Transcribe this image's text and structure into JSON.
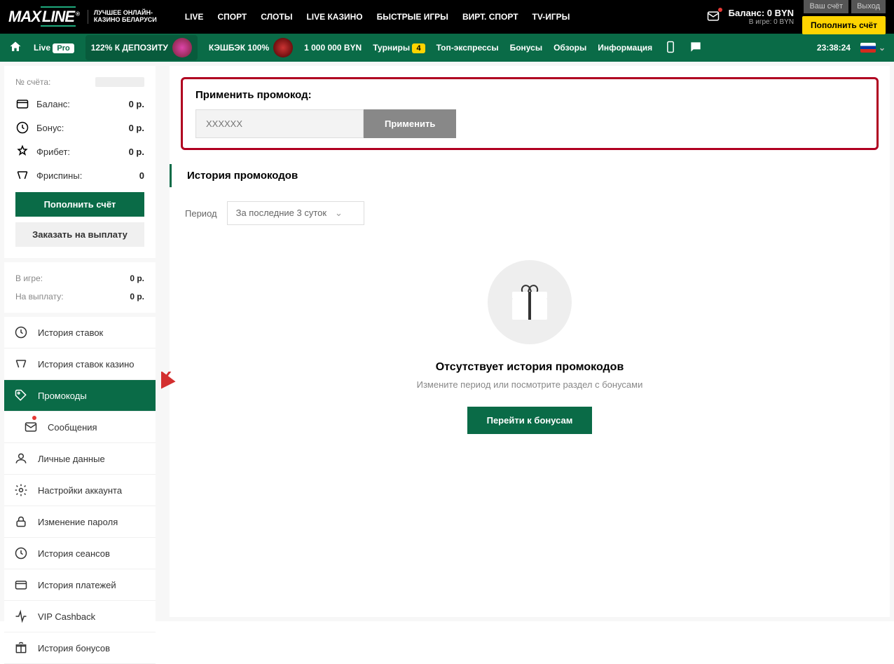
{
  "header": {
    "logo_main": "MAX",
    "logo_sub": "LINE",
    "tagline1": "ЛУЧШЕЕ ОНЛАЙН-",
    "tagline2": "КАЗИНО БЕЛАРУСИ",
    "nav": [
      "LIVE",
      "СПОРТ",
      "СЛОТЫ",
      "LIVE КАЗИНО",
      "БЫСТРЫЕ ИГРЫ",
      "ВИРТ. СПОРТ",
      "TV-ИГРЫ"
    ],
    "balance": "Баланс: 0 BYN",
    "in_game": "В игре: 0 BYN",
    "btn_account": "Ваш счёт",
    "btn_exit": "Выход",
    "btn_deposit": "Пополнить счёт"
  },
  "subheader": {
    "live": "Live",
    "pro": "Pro",
    "deposit_bonus": "122% К ДЕПОЗИТУ",
    "cashback": "КЭШБЭК 100%",
    "million": "1 000 000 BYN",
    "tournaments": "Турниры",
    "tourn_count": "4",
    "top_express": "Топ-экспрессы",
    "bonuses": "Бонусы",
    "reviews": "Обзоры",
    "info": "Информация",
    "time": "23:38:24"
  },
  "sidebar": {
    "account_label": "№ счёта:",
    "rows": [
      {
        "label": "Баланс:",
        "value": "0 р."
      },
      {
        "label": "Бонус:",
        "value": "0 р."
      },
      {
        "label": "Фрибет:",
        "value": "0 р."
      },
      {
        "label": "Фриспины:",
        "value": "0"
      }
    ],
    "btn_deposit": "Пополнить счёт",
    "btn_withdraw": "Заказать на выплату",
    "in_game": {
      "label": "В игре:",
      "value": "0 р."
    },
    "to_payout": {
      "label": "На выплату:",
      "value": "0 р."
    },
    "menu": [
      "История ставок",
      "История ставок казино",
      "Промокоды",
      "Сообщения",
      "Личные данные",
      "Настройки аккаунта",
      "Изменение пароля",
      "История сеансов",
      "История платежей",
      "VIP Cashback",
      "История бонусов"
    ]
  },
  "main": {
    "promo_title": "Применить промокод:",
    "promo_placeholder": "XXXXXX",
    "promo_btn": "Применить",
    "history_title": "История промокодов",
    "period_label": "Период",
    "period_value": "За последние 3 суток",
    "empty_title": "Отсутствует история промокодов",
    "empty_sub": "Измените период или посмотрите раздел с бонусами",
    "btn_bonuses": "Перейти к бонусам"
  }
}
